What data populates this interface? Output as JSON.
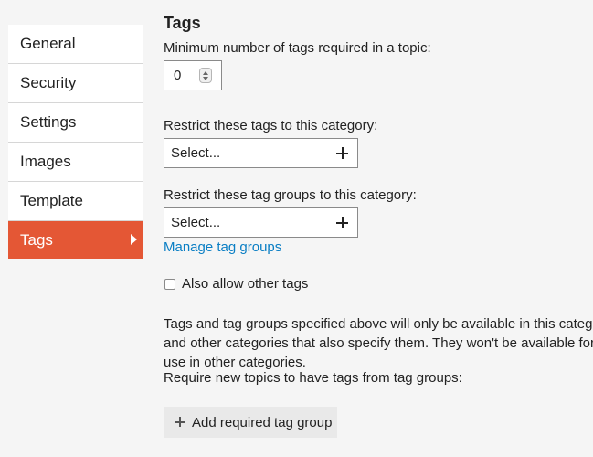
{
  "sidebar": {
    "items": [
      {
        "label": "General",
        "active": false
      },
      {
        "label": "Security",
        "active": false
      },
      {
        "label": "Settings",
        "active": false
      },
      {
        "label": "Images",
        "active": false
      },
      {
        "label": "Template",
        "active": false
      },
      {
        "label": "Tags",
        "active": true
      }
    ]
  },
  "main": {
    "title": "Tags",
    "min_tags_label": "Minimum number of tags required in a topic:",
    "min_tags_value": "0",
    "restrict_tags_label": "Restrict these tags to this category:",
    "restrict_tags_placeholder": "Select...",
    "restrict_groups_label": "Restrict these tag groups to this category:",
    "restrict_groups_placeholder": "Select...",
    "manage_link": "Manage tag groups",
    "allow_other_label": "Also allow other tags",
    "allow_other_checked": false,
    "info_text": "Tags and tag groups specified above will only be available in this category and other categories that also specify them. They won't be available for use in other categories.",
    "require_label": "Require new topics to have tags from tag groups:",
    "add_button_label": "Add required tag group"
  },
  "colors": {
    "accent": "#e45735",
    "link": "#0a7ec4",
    "background": "#f5f5f5"
  }
}
